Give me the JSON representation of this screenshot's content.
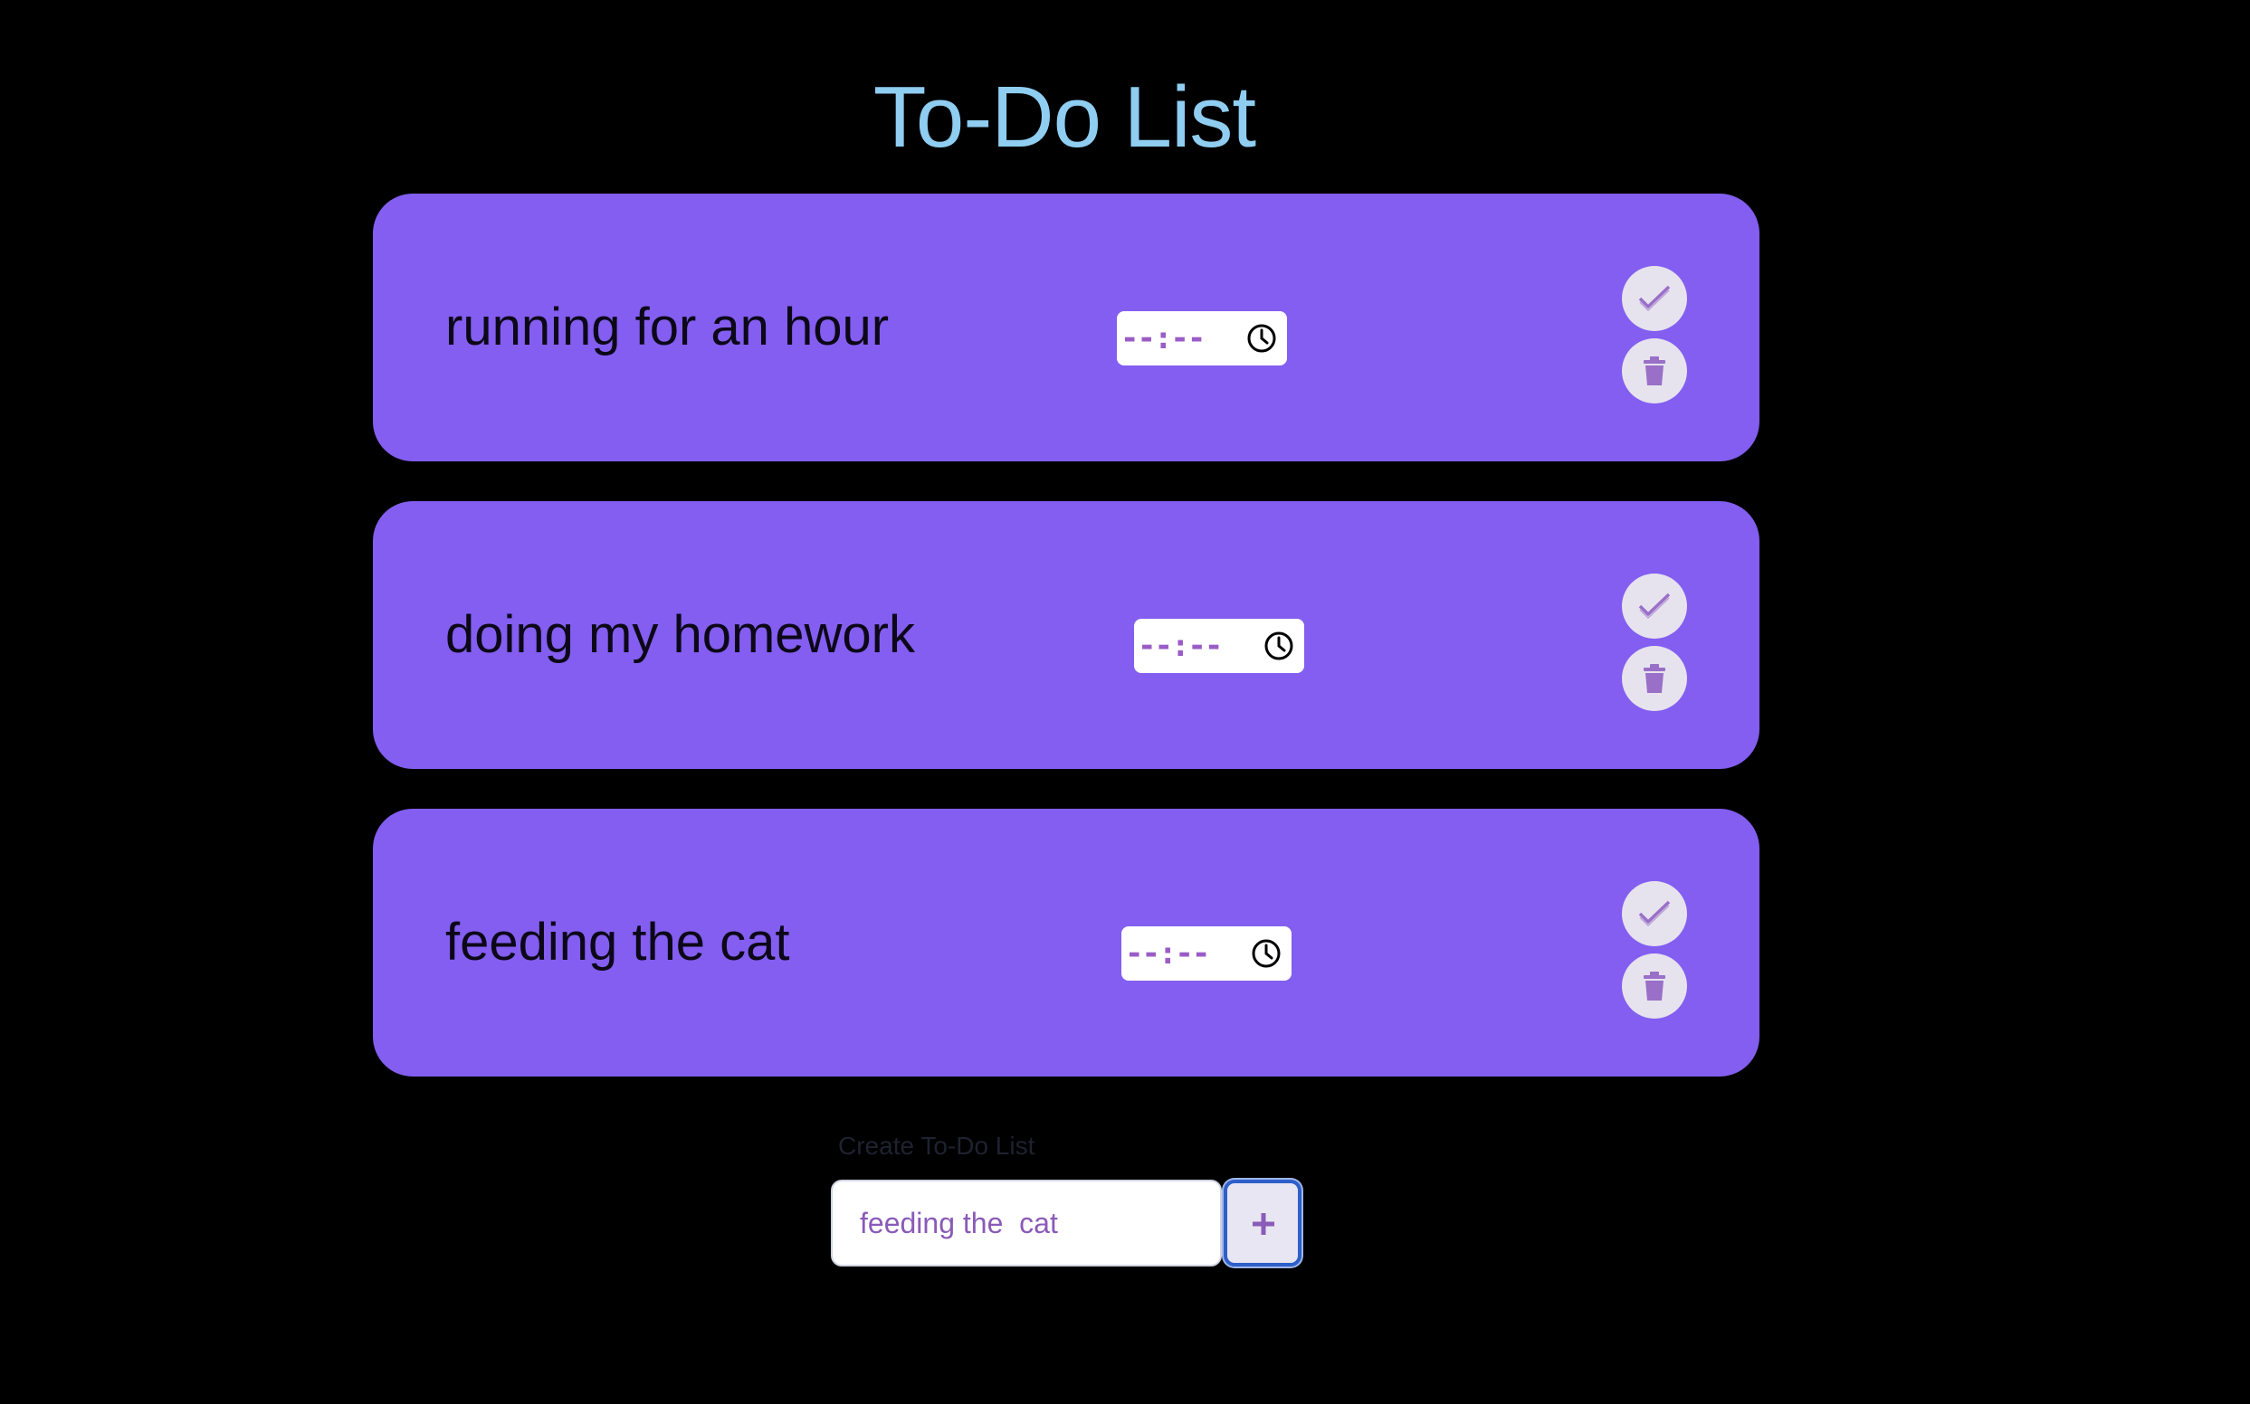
{
  "header": {
    "title": "To-Do List"
  },
  "tasks": [
    {
      "text": "running for an hour",
      "time_placeholder": "--:--"
    },
    {
      "text": "doing my homework",
      "time_placeholder": "--:--"
    },
    {
      "text": "feeding the cat",
      "time_placeholder": "--:--"
    }
  ],
  "icons": {
    "time": "clock-icon",
    "complete": "checkmark-icon",
    "delete": "trash-icon",
    "add": "plus-icon"
  },
  "create": {
    "label": "Create To-Do List",
    "input_value": "feeding the  cat",
    "add_button_icon": "plus-icon"
  },
  "colors": {
    "background": "#000000",
    "title": "#8fcdf1",
    "card": "#835ef0",
    "accent": "#9a5cc6",
    "focus_ring": "#2f5fc9"
  }
}
